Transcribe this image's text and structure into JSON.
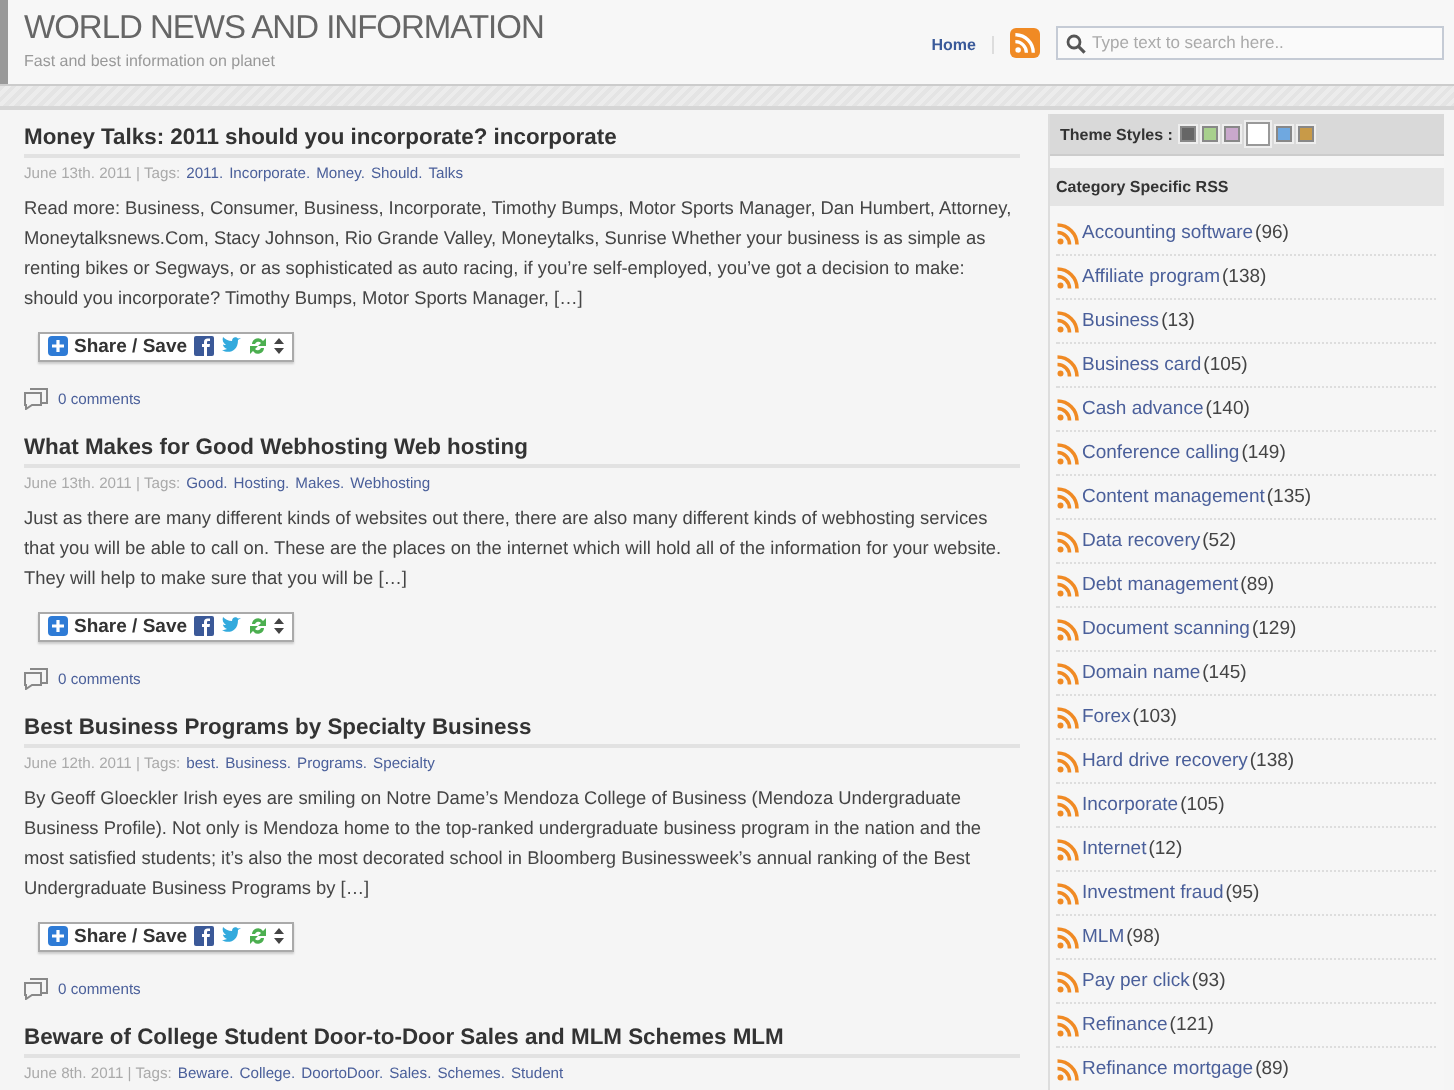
{
  "header": {
    "title": "WORLD NEWS AND INFORMATION",
    "tagline": "Fast and best information on planet",
    "nav": [
      "Home"
    ],
    "search": {
      "placeholder": "Type text to search here.."
    }
  },
  "posts": [
    {
      "title": "Money Talks: 2011 should you incorporate? incorporate",
      "meta": "June 13th. 2011 | Tags:",
      "tags": [
        "2011.",
        "Incorporate.",
        "Money.",
        "Should.",
        "Talks"
      ],
      "excerpt": "Read more: Business, Consumer, Business, Incorporate, Timothy Bumps, Motor Sports Manager, Dan Humbert, Attorney, Moneytalksnews.Com, Stacy Johnson, Rio Grande Valley, Moneytalks, Sunrise Whether your business is as simple as renting bikes or Segways, or as sophisticated as auto racing, if you’re self-employed, you’ve got a decision to make: should you incorporate? Timothy Bumps, Motor Sports Manager, […]",
      "share": "Share / Save",
      "comments": "0 comments"
    },
    {
      "title": "What Makes for Good Webhosting Web hosting",
      "meta": "June 13th. 2011 | Tags:",
      "tags": [
        "Good.",
        "Hosting.",
        "Makes.",
        "Webhosting"
      ],
      "excerpt": "Just as there are many different kinds of websites out there, there are also many different kinds of webhosting services that you will be able to call on. These are the places on the internet which will hold all of the information for your website. They will help to make sure that you will be […]",
      "share": "Share / Save",
      "comments": "0 comments"
    },
    {
      "title": "Best Business Programs by Specialty Business",
      "meta": "June 12th. 2011 | Tags:",
      "tags": [
        "best.",
        "Business.",
        "Programs.",
        "Specialty"
      ],
      "excerpt": "By Geoff Gloeckler Irish eyes are smiling on Notre Dame’s Mendoza College of Business (Mendoza Undergraduate Business Profile). Not only is Mendoza home to the top-ranked undergraduate business program in the nation and the most satisfied students; it’s also the most decorated school in Bloomberg Businessweek’s annual ranking of the Best Undergraduate Business Programs by […]",
      "share": "Share / Save",
      "comments": "0 comments"
    },
    {
      "title": "Beware of College Student Door-to-Door Sales and MLM Schemes MLM",
      "meta": "June 8th. 2011 | Tags:",
      "tags": [
        "Beware.",
        "College.",
        "DoortoDoor.",
        "Sales.",
        "Schemes.",
        "Student"
      ]
    }
  ],
  "sidebar": {
    "theme_label": "Theme Styles :",
    "themes": [
      {
        "color": "#666666",
        "selected": false
      },
      {
        "color": "#a8d08d",
        "selected": false
      },
      {
        "color": "#c9a8cc",
        "selected": false
      },
      {
        "color": "#ffffff",
        "selected": true
      },
      {
        "color": "#6fa8e0",
        "selected": false
      },
      {
        "color": "#c89a48",
        "selected": false
      }
    ],
    "rss_heading": "Category Specific RSS",
    "categories": [
      {
        "name": "Accounting software",
        "count": "(96)"
      },
      {
        "name": "Affiliate program",
        "count": "(138)"
      },
      {
        "name": "Business",
        "count": "(13)"
      },
      {
        "name": "Business card",
        "count": "(105)"
      },
      {
        "name": "Cash advance",
        "count": "(140)"
      },
      {
        "name": "Conference calling",
        "count": "(149)"
      },
      {
        "name": "Content management",
        "count": "(135)"
      },
      {
        "name": "Data recovery",
        "count": "(52)"
      },
      {
        "name": "Debt management",
        "count": "(89)"
      },
      {
        "name": "Document scanning",
        "count": "(129)"
      },
      {
        "name": "Domain name",
        "count": "(145)"
      },
      {
        "name": "Forex",
        "count": "(103)"
      },
      {
        "name": "Hard drive recovery",
        "count": "(138)"
      },
      {
        "name": "Incorporate",
        "count": "(105)"
      },
      {
        "name": "Internet",
        "count": "(12)"
      },
      {
        "name": "Investment fraud",
        "count": "(95)"
      },
      {
        "name": "MLM",
        "count": "(98)"
      },
      {
        "name": "Pay per click",
        "count": "(93)"
      },
      {
        "name": "Refinance",
        "count": "(121)"
      },
      {
        "name": "Refinance mortgage",
        "count": "(89)"
      }
    ]
  }
}
